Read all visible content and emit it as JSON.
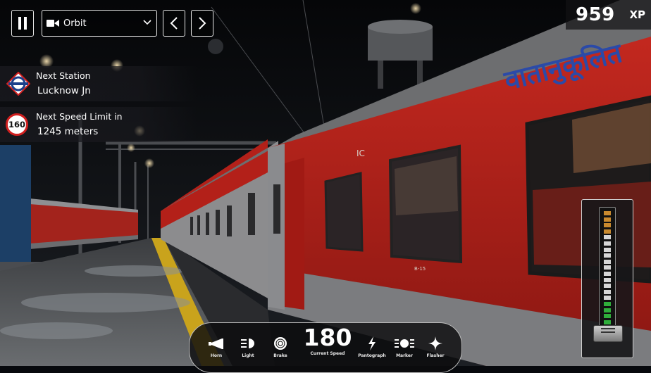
{
  "hud": {
    "camera_mode": "Orbit",
    "xp_value": "959",
    "xp_label": "XP"
  },
  "next_station": {
    "title": "Next Station",
    "name": "Lucknow Jn"
  },
  "speed_limit": {
    "title": "Next Speed Limit in",
    "distance": "1245 meters",
    "limit": "160"
  },
  "controls": {
    "horn": "Horn",
    "light": "Light",
    "brake": "Brake",
    "current_speed": "180",
    "current_speed_label": "Current Speed",
    "pantograph": "Pantograph",
    "marker": "Marker",
    "flasher": "Flasher"
  },
  "coach": {
    "hindi_text": "वातानुकूलित",
    "class_code": "IC",
    "coach_number": "B-15"
  },
  "throttle": {
    "segments": 20,
    "active_segments": 4,
    "notch_level": 0.0
  },
  "colors": {
    "coach_red": "#b32019",
    "coach_grey": "#8c8c8e",
    "roof_grey": "#6d6e70",
    "platform_yellow": "#c9a31c",
    "throttle_orange": "#c98a2e",
    "throttle_green": "#2fae3a",
    "limit_red": "#d11f1f"
  },
  "icons": [
    "pause-icon",
    "camera-icon",
    "chevron-down-icon",
    "chevron-left-icon",
    "chevron-right-icon",
    "railway-station-icon",
    "speed-limit-sign",
    "horn-icon",
    "headlight-icon",
    "brake-icon",
    "pantograph-icon",
    "marker-light-icon",
    "flasher-icon"
  ]
}
